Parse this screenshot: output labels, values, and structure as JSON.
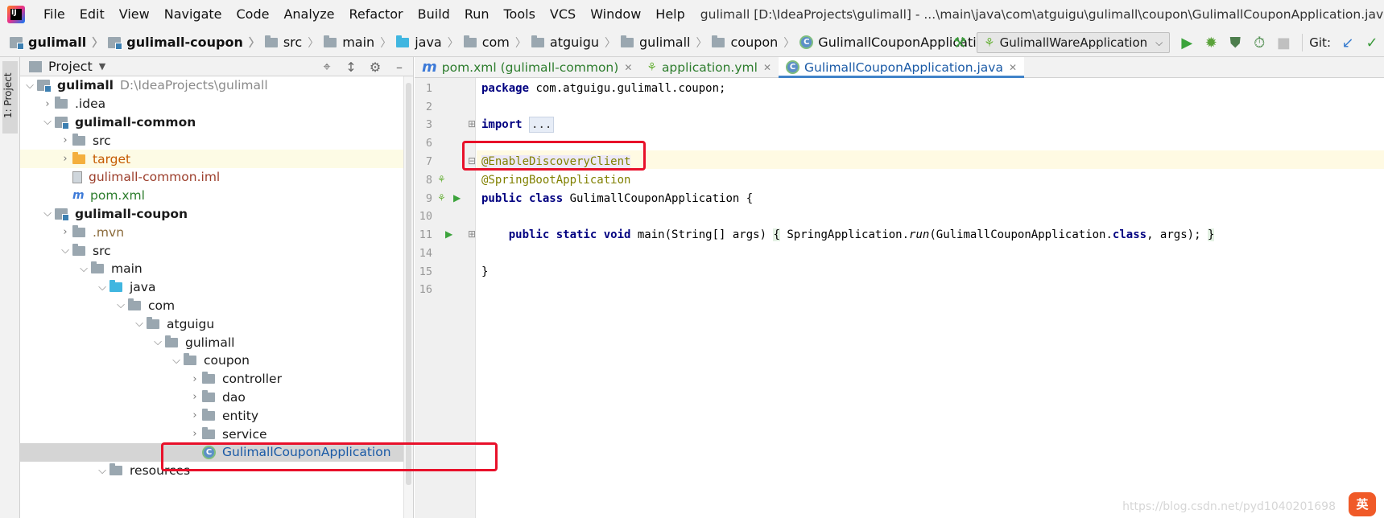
{
  "menubar": {
    "items": [
      "File",
      "Edit",
      "View",
      "Navigate",
      "Code",
      "Analyze",
      "Refactor",
      "Build",
      "Run",
      "Tools",
      "VCS",
      "Window",
      "Help"
    ],
    "window_title": "gulimall [D:\\IdeaProjects\\gulimall] - ...\\main\\java\\com\\atguigu\\gulimall\\coupon\\GulimallCouponApplication.java [gulimall-coupon]"
  },
  "breadcrumb": [
    "gulimall",
    "gulimall-coupon",
    "src",
    "main",
    "java",
    "com",
    "atguigu",
    "gulimall",
    "coupon",
    "GulimallCouponApplication"
  ],
  "toolbar": {
    "run_config": "GulimallWareApplication",
    "git_label": "Git:"
  },
  "left_stripe": {
    "tab": "1: Project"
  },
  "project_panel": {
    "title": "Project",
    "tree": [
      {
        "label": "gulimall",
        "path": "D:\\IdeaProjects\\gulimall"
      },
      {
        "label": ".idea"
      },
      {
        "label": "gulimall-common"
      },
      {
        "label": "src"
      },
      {
        "label": "target"
      },
      {
        "label": "gulimall-common.iml"
      },
      {
        "label": "pom.xml"
      },
      {
        "label": "gulimall-coupon"
      },
      {
        "label": ".mvn"
      },
      {
        "label": "src"
      },
      {
        "label": "main"
      },
      {
        "label": "java"
      },
      {
        "label": "com"
      },
      {
        "label": "atguigu"
      },
      {
        "label": "gulimall"
      },
      {
        "label": "coupon"
      },
      {
        "label": "controller"
      },
      {
        "label": "dao"
      },
      {
        "label": "entity"
      },
      {
        "label": "service"
      },
      {
        "label": "GulimallCouponApplication"
      },
      {
        "label": "resources"
      }
    ]
  },
  "editor": {
    "tabs": [
      {
        "label": "pom.xml (gulimall-common)"
      },
      {
        "label": "application.yml"
      },
      {
        "label": "GulimallCouponApplication.java"
      }
    ],
    "line_numbers": [
      "1",
      "2",
      "3",
      "6",
      "7",
      "8",
      "9",
      "10",
      "11",
      "14",
      "15",
      "16"
    ],
    "code": {
      "l1_kw": "package",
      "l1_rest": " com.atguigu.gulimall.coupon;",
      "l3_kw": "import",
      "l3_fold": "...",
      "l7_ann": "@EnableDiscoveryClient",
      "l8_ann": "@SpringBootApplication",
      "l9_kw": "public class",
      "l9_rest": " GulimallCouponApplication {",
      "l11_indent": "    ",
      "l11_kw": "public static void",
      "l11_a": " main(String[] args) ",
      "l11_ob": "{",
      "l11_b": " SpringApplication.",
      "l11_run": "run",
      "l11_c": "(GulimallCouponApplication.",
      "l11_class": "class",
      "l11_d": ", args); ",
      "l11_cb": "}",
      "l15": "}"
    }
  },
  "watermark": "https://blog.csdn.net/pyd1040201698",
  "ime_badge": "英"
}
